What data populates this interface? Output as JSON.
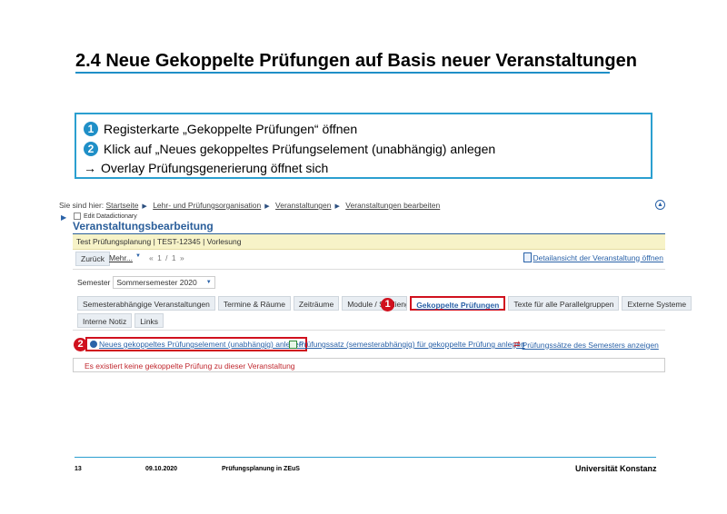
{
  "slide": {
    "title": "2.4 Neue Gekoppelte Prüfungen auf Basis neuer Veranstaltungen",
    "steps": [
      {
        "num": "1",
        "text": "Registerkarte „Gekoppelte Prüfungen“ öffnen"
      },
      {
        "num": "2",
        "text": "Klick auf „Neues gekoppeltes Prüfungselement (unabhängig) anlegen"
      },
      {
        "arrow": "→",
        "text": "Overlay Prüfungsgenerierung öffnet sich"
      }
    ],
    "markers": [
      "1",
      "2"
    ],
    "accent_color": "#1f8fc7",
    "marker_color": "#d0111e"
  },
  "app": {
    "breadcrumb": {
      "prefix": "Sie sind hier:",
      "items": [
        "Startseite",
        "Lehr- und Prüfungsorganisation",
        "Veranstaltungen",
        "Veranstaltungen bearbeiten"
      ]
    },
    "up_icon": "up-arrow-icon",
    "edit_dictionary_label": "Edit Datadictionary",
    "page_header": "Veranstaltungsbearbeitung",
    "info": "Test Prüfungsplanung | TEST-12345 | Vorlesung",
    "zuruck_label": "Zurück",
    "mehr_label": "Mehr...",
    "pager": "« 1 / 1 »",
    "detail_link": "Detailansicht der Veranstaltung öffnen",
    "semester_label": "Semester",
    "semester_value": "Sommersemester 2020",
    "tabs_row1": [
      "Semesterabhängige Veranstaltungen",
      "Termine & Räume",
      "Zeiträume",
      "Module / Studiengän",
      "Gekoppelte Prüfungen",
      "Texte für alle Parallelgruppen",
      "Externe Systeme"
    ],
    "tabs_row2": [
      "Interne Notiz",
      "Links"
    ],
    "actions": [
      "Neues gekoppeltes Prüfungselement (unabhängig) anlegen",
      "Prüfungssatz (semesterabhängig) für gekoppelte Prüfung anlegen",
      "Prüfungssätze des Semesters anzeigen"
    ],
    "message": "Es existiert keine gekoppelte Prüfung zu dieser Veranstaltung"
  },
  "footer": {
    "page": "13",
    "date": "09.10.2020",
    "title": "Prüfungsplanung  in ZEuS",
    "university": "Universität Konstanz"
  }
}
